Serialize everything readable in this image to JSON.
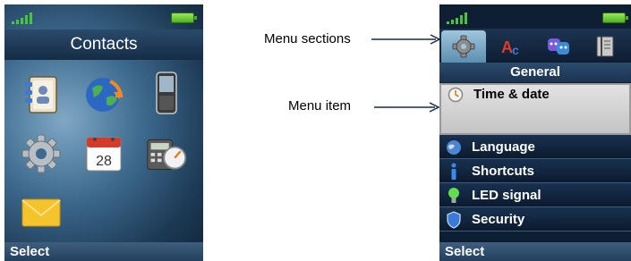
{
  "left_screen": {
    "title": "Contacts",
    "softkey": "Select",
    "icons": [
      {
        "name": "contacts-book-icon"
      },
      {
        "name": "globe-icon"
      },
      {
        "name": "phone-handset-icon"
      },
      {
        "name": "settings-gear-icon"
      },
      {
        "name": "calendar-icon",
        "text": "28"
      },
      {
        "name": "calculator-timer-icon"
      },
      {
        "name": "envelope-icon"
      }
    ],
    "colors": {
      "accent": "#4cb320",
      "title_bg": "#1f3b5a"
    }
  },
  "right_screen": {
    "section_title": "General",
    "softkey": "Select",
    "tabs": [
      {
        "name": "general-tab-icon",
        "active": true
      },
      {
        "name": "language-ab-tab-icon",
        "active": false
      },
      {
        "name": "theme-masks-tab-icon",
        "active": false
      },
      {
        "name": "book-tab-icon",
        "active": false
      }
    ],
    "menu_items": [
      {
        "label": "Time & date",
        "icon": "clock-icon",
        "selected": true
      },
      {
        "label": "Language",
        "icon": "globe-icon",
        "selected": false
      },
      {
        "label": "Shortcuts",
        "icon": "info-icon",
        "selected": false
      },
      {
        "label": "LED signal",
        "icon": "bulb-icon",
        "selected": false
      },
      {
        "label": "Security",
        "icon": "shield-icon",
        "selected": false
      }
    ]
  },
  "annotations": {
    "menu_sections": "Menu sections",
    "menu_item": "Menu item"
  }
}
